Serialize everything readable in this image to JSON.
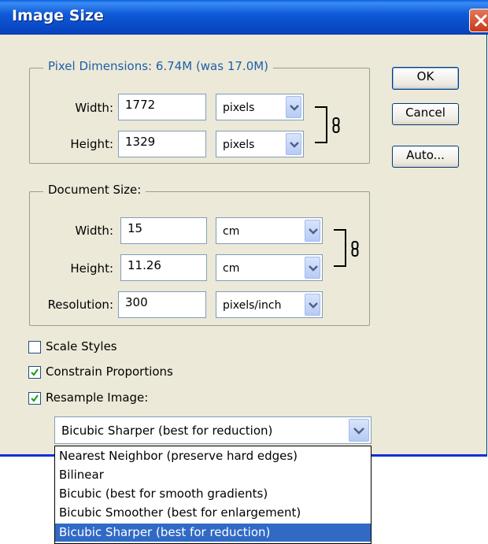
{
  "window": {
    "title": "Image Size"
  },
  "pixel_dimensions": {
    "legend": "Pixel Dimensions:  6.74M (was 17.0M)",
    "width_label": "Width:",
    "width_value": "1772",
    "width_unit": "pixels",
    "height_label": "Height:",
    "height_value": "1329",
    "height_unit": "pixels"
  },
  "document_size": {
    "legend": "Document Size:",
    "width_label": "Width:",
    "width_value": "15",
    "width_unit": "cm",
    "height_label": "Height:",
    "height_value": "11.26",
    "height_unit": "cm",
    "resolution_label": "Resolution:",
    "resolution_value": "300",
    "resolution_unit": "pixels/inch"
  },
  "buttons": {
    "ok": "OK",
    "cancel": "Cancel",
    "auto": "Auto..."
  },
  "options": {
    "scale_styles": {
      "label": "Scale Styles",
      "checked": false
    },
    "constrain_proportions": {
      "label": "Constrain Proportions",
      "checked": true
    },
    "resample_image": {
      "label": "Resample Image:",
      "checked": true
    }
  },
  "resample_select": {
    "value": "Bicubic Sharper (best for reduction)",
    "options": [
      "Nearest Neighbor (preserve hard edges)",
      "Bilinear",
      "Bicubic (best for smooth gradients)",
      "Bicubic Smoother (best for enlargement)",
      "Bicubic Sharper (best for reduction)"
    ],
    "highlighted_index": 4
  },
  "colors": {
    "title_bar": "#0a5fe0",
    "legend_text": "#1f5ea8",
    "selection": "#316ac5",
    "dialog_bg": "#ece9d8"
  }
}
